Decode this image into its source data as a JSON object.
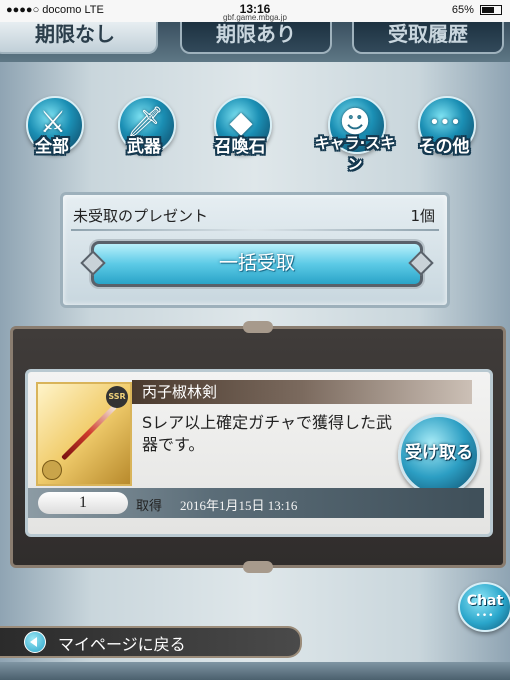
{
  "status_bar": {
    "carrier": "●●●●○ docomo  LTE",
    "time": "13:16",
    "url": "gbf.game.mbga.jp",
    "battery": "65%"
  },
  "tabs": [
    {
      "label": "期限なし",
      "active": true
    },
    {
      "label": "期限あり",
      "active": false
    },
    {
      "label": "受取履歴",
      "active": false
    }
  ],
  "categories": [
    {
      "label": "全部",
      "icon": "all-items-icon",
      "glyph": "⚔"
    },
    {
      "label": "武器",
      "icon": "sword-icon",
      "glyph": "🗡"
    },
    {
      "label": "召喚石",
      "icon": "crystal-icon",
      "glyph": "◆"
    },
    {
      "label": "キャラ·スキン",
      "icon": "character-icon",
      "glyph": "☻"
    },
    {
      "label": "その他",
      "icon": "more-icon",
      "glyph": "•••"
    }
  ],
  "present_box": {
    "title": "未受取のプレゼント",
    "count": "1個",
    "bulk_button": "一括受取"
  },
  "item": {
    "name": "丙子椒林剣",
    "rarity_badge": "SSR",
    "description": "Sレア以上確定ガチャで獲得した武器です。",
    "receive_button": "受け取る",
    "quantity": "1",
    "acquired_label": "取得",
    "acquired_date": "2016年1月15日 13:16"
  },
  "chat": {
    "label": "Chat",
    "dots": "•••"
  },
  "back": {
    "label": "マイページに戻る"
  },
  "colors": {
    "accent_blue": "#2aa4c8",
    "frame_dark": "#302d2c",
    "tab_active": "#e7eef1"
  }
}
